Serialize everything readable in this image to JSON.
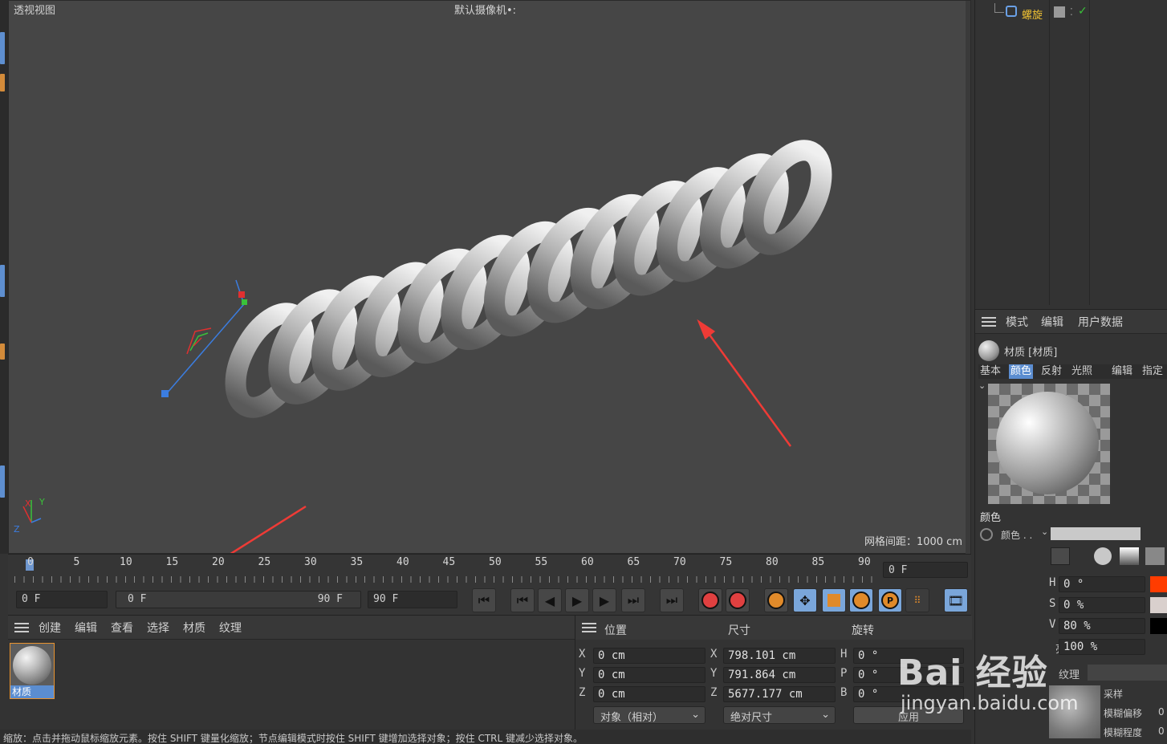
{
  "viewport": {
    "title": "透视视图",
    "camera": "默认摄像机",
    "camera_suffix": "•:",
    "grid_info": "网格间距：1000 cm"
  },
  "timeline": {
    "ticks": [
      "0",
      "5",
      "10",
      "15",
      "20",
      "25",
      "30",
      "35",
      "40",
      "45",
      "50",
      "55",
      "60",
      "65",
      "70",
      "75",
      "80",
      "85",
      "90"
    ],
    "current_frame": "0 F"
  },
  "transport": {
    "start": "0 F",
    "range_start": "0 F",
    "range_end": "90 F",
    "end": "90 F"
  },
  "material_manager": {
    "menu": [
      "创建",
      "编辑",
      "查看",
      "选择",
      "材质",
      "纹理"
    ],
    "materials": [
      {
        "name": "材质"
      }
    ]
  },
  "coordinates": {
    "headers": {
      "position": "位置",
      "size": "尺寸",
      "rotation": "旋转"
    },
    "rows": [
      {
        "axis": "X",
        "pos": "0 cm",
        "size_axis": "X",
        "size": "798.101 cm",
        "rot_axis": "H",
        "rot": "0 °"
      },
      {
        "axis": "Y",
        "pos": "0 cm",
        "size_axis": "Y",
        "size": "791.864 cm",
        "rot_axis": "P",
        "rot": "0 °"
      },
      {
        "axis": "Z",
        "pos": "0 cm",
        "size_axis": "Z",
        "size": "5677.177 cm",
        "rot_axis": "B",
        "rot": "0 °"
      }
    ],
    "mode": "对象（相对）",
    "size_mode": "绝对尺寸",
    "apply": "应用"
  },
  "status_bar": "缩放：点击并拖动鼠标缩放元素。按住 SHIFT 键量化缩放；节点编辑模式时按住 SHIFT 键增加选择对象；按住 CTRL 键减少选择对象。",
  "object_manager": {
    "object_name": "螺旋"
  },
  "attributes": {
    "menu": [
      "模式",
      "编辑",
      "用户数据"
    ],
    "title": "材质 [材质]",
    "tabs": [
      "基本",
      "颜色",
      "反射",
      "光照",
      "编辑",
      "指定"
    ],
    "active_tab": "颜色",
    "section": "颜色",
    "color_label": "颜色 . .",
    "hsv": [
      {
        "label": "H",
        "value": "0 °",
        "swatch": "#ff3c00"
      },
      {
        "label": "S",
        "value": "0 %",
        "swatch": "#d9d0cd"
      },
      {
        "label": "V",
        "value": "80 %",
        "swatch": "#000000"
      }
    ],
    "brightness_label": "亮度",
    "brightness_value": "100 %",
    "texture_label": "纹理",
    "sampling_label": "采样",
    "blur_offset_label": "模糊偏移",
    "blur_scale_label": "模糊程度",
    "blur_offset_value": "0",
    "blur_scale_value": "0"
  },
  "watermark": {
    "text": "Bai 经验",
    "url": "jingyan.baidu.com"
  }
}
